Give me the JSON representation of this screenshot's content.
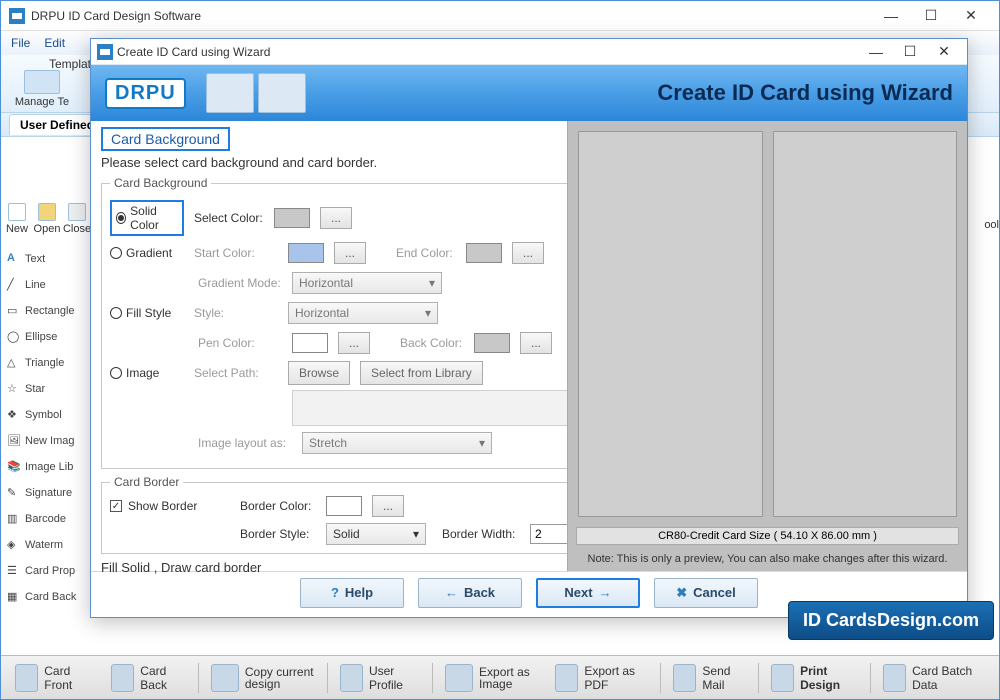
{
  "app": {
    "title": "DRPU ID Card Design Software"
  },
  "menubar": {
    "file": "File",
    "edit": "Edit"
  },
  "templates_label": "Templates",
  "manage_templates": "Manage Te",
  "toolbar_small": {
    "new": "New",
    "open": "Open",
    "close": "Close"
  },
  "tab": "User Defined",
  "right_tool": "ool",
  "sidebar": {
    "items": [
      {
        "label": "Text"
      },
      {
        "label": "Line"
      },
      {
        "label": "Rectangle"
      },
      {
        "label": "Ellipse"
      },
      {
        "label": "Triangle"
      },
      {
        "label": "Star"
      },
      {
        "label": "Symbol"
      },
      {
        "label": "New Imag"
      },
      {
        "label": "Image Lib"
      },
      {
        "label": "Signature"
      },
      {
        "label": "Barcode"
      },
      {
        "label": "Waterm"
      },
      {
        "label": "Card Prop"
      },
      {
        "label": "Card Back"
      }
    ]
  },
  "wizard": {
    "title": "Create ID Card using Wizard",
    "logo": "DRPU",
    "heading": "Create ID Card using Wizard",
    "section_title": "Card Background",
    "section_sub": "Please select card background and card border.",
    "bg_legend": "Card Background",
    "solid": "Solid Color",
    "select_color": "Select Color:",
    "gradient": "Gradient",
    "start_color": "Start Color:",
    "end_color": "End Color:",
    "gradient_mode": "Gradient Mode:",
    "horizontal": "Horizontal",
    "fill_style": "Fill Style",
    "style": "Style:",
    "pen_color": "Pen Color:",
    "back_color": "Back Color:",
    "image": "Image",
    "select_path": "Select Path:",
    "browse": "Browse",
    "from_library": "Select from Library",
    "image_layout": "Image layout as:",
    "stretch": "Stretch",
    "border_legend": "Card Border",
    "show_border": "Show Border",
    "border_color": "Border Color:",
    "border_style": "Border Style:",
    "solid_style": "Solid",
    "border_width": "Border Width:",
    "border_width_val": "2",
    "summary": "Fill Solid , Draw card border",
    "more": "...",
    "help": "Help",
    "back": "Back",
    "next": "Next",
    "cancel": "Cancel",
    "preview_label": "CR80-Credit Card Size ( 54.10 X 86.00 mm )",
    "preview_note": "Note: This is only a preview, You can also make changes after this wizard."
  },
  "bottom": {
    "card_front": "Card Front",
    "card_back": "Card Back",
    "copy_design": "Copy current design",
    "user_profile": "User Profile",
    "export_image": "Export as Image",
    "export_pdf": "Export as PDF",
    "send_mail": "Send Mail",
    "print_design": "Print Design",
    "batch_data": "Card Batch Data"
  },
  "watermark": "ID CardsDesign.com"
}
